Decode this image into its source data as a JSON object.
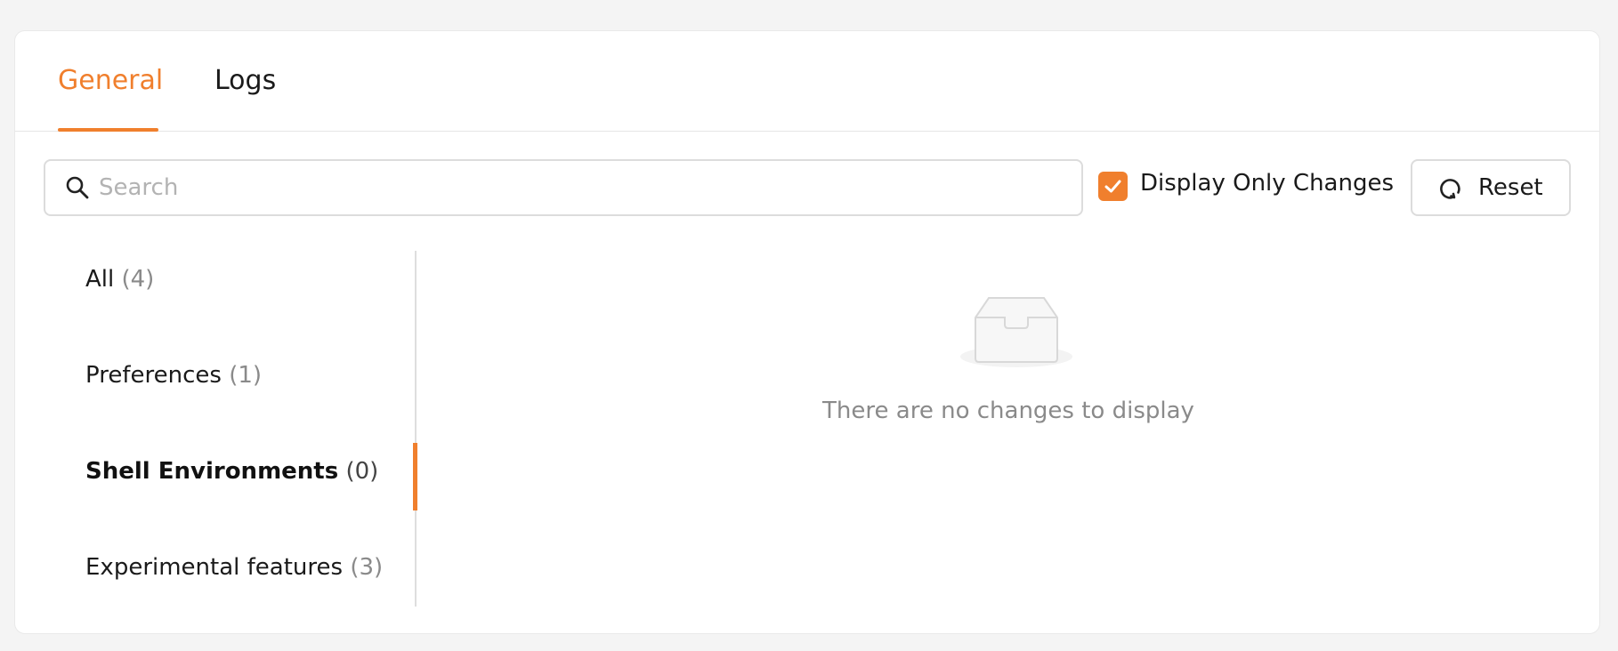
{
  "tabs": [
    {
      "label": "General"
    },
    {
      "label": "Logs"
    }
  ],
  "search": {
    "placeholder": "Search",
    "value": ""
  },
  "filters": {
    "display_only_changes_label": "Display Only Changes",
    "display_only_changes_checked": true
  },
  "reset": {
    "label": "Reset",
    "icon": "refresh-icon"
  },
  "categories": [
    {
      "name": "All",
      "count": "(4)"
    },
    {
      "name": "Preferences",
      "count": "(1)"
    },
    {
      "name": "Shell Environments",
      "count": "(0)"
    },
    {
      "name": "Experimental features",
      "count": "(3)"
    }
  ],
  "active_category": "Shell Environments",
  "empty_state": {
    "icon": "inbox-icon",
    "message": "There are no changes to display"
  },
  "colors": {
    "accent": "#f07f2d",
    "muted_text": "#8a8a8a"
  }
}
